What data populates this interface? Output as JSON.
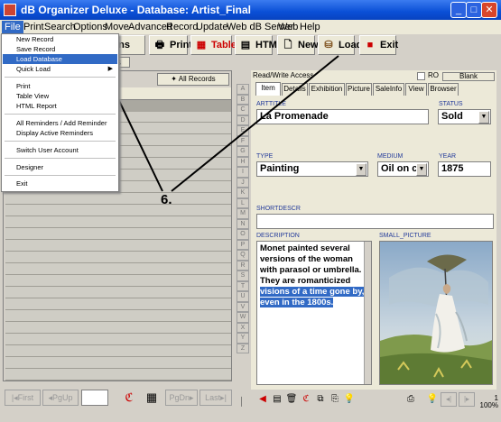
{
  "window": {
    "title": "dB Organizer Deluxe - Database: Artist_Final"
  },
  "menubar": [
    "File",
    "Print",
    "Search",
    "Options",
    "Move",
    "Advanced",
    "Record",
    "Update",
    "Web dB Server",
    "Web",
    "Help"
  ],
  "toolbar": {
    "options": "ptions",
    "print": "Print",
    "table": "Table",
    "html": "HTML",
    "new": "New",
    "load": "Load",
    "exit": "Exit"
  },
  "tabstrip_stub": "ws",
  "file_menu": {
    "items": [
      "New Record",
      "Save Record",
      "Load Database",
      "Quick Load",
      "Print",
      "Table View",
      "HTML Report",
      "All Reminders / Add Reminder",
      "Display Active Reminders",
      "Switch User Account",
      "Designer",
      "Exit"
    ],
    "highlighted": "Load Database"
  },
  "left": {
    "all_records": "All Records",
    "nav": {
      "first": "First",
      "pgup": "PgUp",
      "pgdn": "PgDn",
      "last": "Last"
    }
  },
  "alphabet": [
    "A",
    "B",
    "C",
    "D",
    "E",
    "F",
    "G",
    "H",
    "I",
    "J",
    "K",
    "L",
    "M",
    "N",
    "O",
    "P",
    "Q",
    "R",
    "S",
    "T",
    "U",
    "V",
    "W",
    "X",
    "Y",
    "Z"
  ],
  "right": {
    "readwrite": "Read/Write Access",
    "ro": "RO",
    "blank": "Blank",
    "tabs": [
      "Item",
      "Details",
      "Exhibition",
      "Picture",
      "SaleInfo",
      "View",
      "Browser"
    ],
    "fields": {
      "arttitle": {
        "label": "ARTTITLE",
        "value": "La Promenade"
      },
      "status": {
        "label": "STATUS",
        "value": "Sold"
      },
      "type": {
        "label": "TYPE",
        "value": "Painting"
      },
      "medium": {
        "label": "MEDIUM",
        "value": "Oil on car"
      },
      "year": {
        "label": "YEAR",
        "value": "1875"
      },
      "shortdescr": {
        "label": "SHORTDESCR",
        "value": ""
      },
      "description": {
        "label": "DESCRIPTION",
        "text_plain": "Monet painted several versions of the woman with parasol or umbrella. They are romanticized ",
        "text_highlight": "visions of a time gone by, even in the 1800s."
      },
      "small_picture": {
        "label": "SMALL_PICTURE"
      }
    }
  },
  "status": {
    "count": "1",
    "zoom": "100%"
  },
  "annotation": "6."
}
